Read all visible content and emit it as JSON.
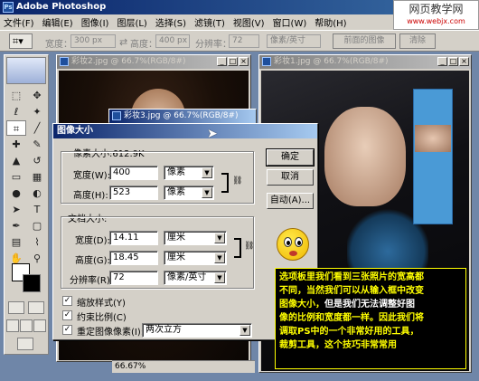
{
  "app": {
    "title": "Adobe Photoshop"
  },
  "watermark": {
    "line1": "网页教学网",
    "line2": "www.webjx.com"
  },
  "menu": [
    "文件(F)",
    "编辑(E)",
    "图像(I)",
    "图层(L)",
    "选择(S)",
    "滤镜(T)",
    "视图(V)",
    "窗口(W)",
    "帮助(H)"
  ],
  "options": {
    "width_label": "宽度：",
    "width_value": "300 px",
    "height_label": "高度：",
    "height_value": "400 px",
    "res_label": "分辨率：",
    "res_value": "72",
    "res_unit": "像素/英寸",
    "front_btn": "前面的图像",
    "clear_btn": "清除"
  },
  "docs": {
    "doc2_title": "彩妆2.jpg @ 66.7%(RGB/8#)",
    "doc1_title": "彩妆1.jpg @ 66.7%(RGB/8#)",
    "doc3_title": "彩妆3.jpg @ 66.7%(RGB/8#)",
    "zoom": "66.67%"
  },
  "dialog": {
    "title": "图像大小",
    "pixel_dims": "像素大小:612.9K",
    "width_label": "宽度(W):",
    "width_value": "400",
    "width_unit": "像素",
    "height_label": "高度(H):",
    "height_value": "523",
    "height_unit": "像素",
    "doc_size": "文档大小:",
    "doc_width_label": "宽度(D):",
    "doc_width_value": "14.11",
    "doc_width_unit": "厘米",
    "doc_height_label": "高度(G):",
    "doc_height_value": "18.45",
    "doc_height_unit": "厘米",
    "res_label": "分辨率(R):",
    "res_value": "72",
    "res_unit": "像素/英寸",
    "ok": "确定",
    "cancel": "取消",
    "auto": "自动(A)...",
    "scale_styles": "缩放样式(Y)",
    "constrain": "约束比例(C)",
    "resample": "重定图像像素(I):",
    "resample_method": "两次立方"
  },
  "caption": {
    "line1": "选项板里我们看到三张照片的宽高都",
    "line2": "不同，当然我们可以从输入框中改变",
    "line3_a": "图像大小，",
    "line3_b": "但是我们无法调整好图",
    "line4": "像的比例和宽度都一样。因此我们将",
    "line5": "调取PS中的一个非常好用的工具，",
    "line6": "裁剪工具，这个技巧非常常用"
  }
}
